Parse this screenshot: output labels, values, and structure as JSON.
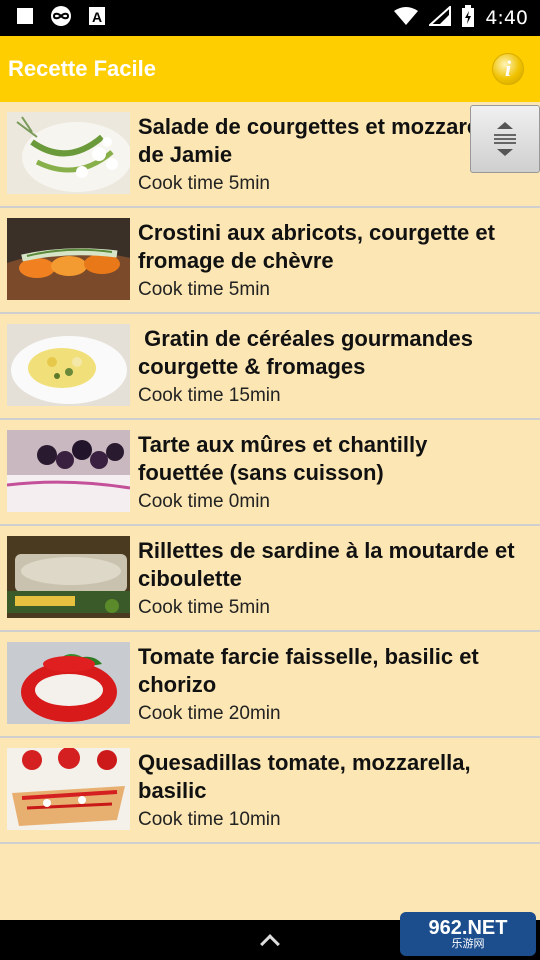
{
  "status_bar": {
    "time": "4:40",
    "icons": [
      "square-icon",
      "infinity-icon",
      "a-box-icon",
      "wifi-icon",
      "signal-icon",
      "battery-charging-icon"
    ]
  },
  "app_bar": {
    "title": "Recette Facile",
    "info_label": "i"
  },
  "recipes": [
    {
      "title": "Salade de courgettes et mozzarella\nde Jamie",
      "cook_time": "Cook time 5min"
    },
    {
      "title": "Crostini aux abricots, courgette et\nfromage de chèvre",
      "cook_time": "Cook time 5min"
    },
    {
      "title": " Gratin de céréales gourmandes\ncourgette & fromages",
      "cook_time": "Cook time 15min"
    },
    {
      "title": "Tarte aux mûres et chantilly\nfouettée (sans cuisson)",
      "cook_time": "Cook time 0min"
    },
    {
      "title": "Rillettes de sardine à la moutarde et\nciboulette",
      "cook_time": "Cook time 5min"
    },
    {
      "title": "Tomate farcie faisselle, basilic et\nchorizo",
      "cook_time": "Cook time 20min"
    },
    {
      "title": "Quesadillas tomate, mozzarella,\nbasilic",
      "cook_time": "Cook time 10min"
    }
  ],
  "watermark": {
    "big": "962.NET",
    "small": "乐游网"
  },
  "colors": {
    "app_bar": "#fece00",
    "background": "#fbe6b4",
    "divider": "#cfcfcf"
  }
}
